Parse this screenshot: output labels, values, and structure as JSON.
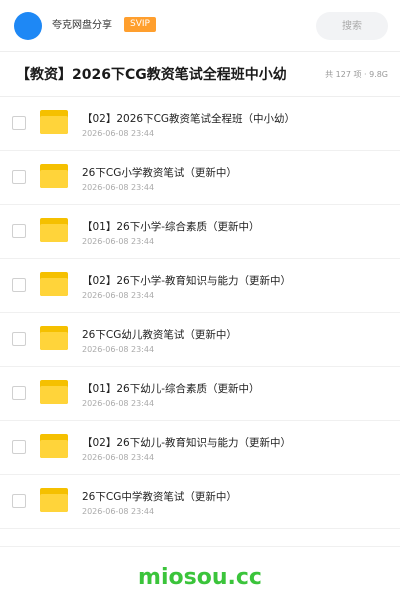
{
  "header": {
    "share_name": "夸克网盘分享",
    "badge": "SVIP",
    "search_placeholder": "搜索"
  },
  "folder": {
    "title": "【教资】2026下CG教资笔试全程班中小幼",
    "meta": "共 127 项 · 9.8G"
  },
  "items": [
    {
      "name": "【02】2026下CG教资笔试全程班（中小幼）",
      "date": "2026-06-08 23:44"
    },
    {
      "name": "26下CG小学教资笔试（更新中）",
      "date": "2026-06-08 23:44"
    },
    {
      "name": "【01】26下小学-综合素质（更新中）",
      "date": "2026-06-08 23:44"
    },
    {
      "name": "【02】26下小学-教育知识与能力（更新中）",
      "date": "2026-06-08 23:44"
    },
    {
      "name": "26下CG幼儿教资笔试（更新中）",
      "date": "2026-06-08 23:44"
    },
    {
      "name": "【01】26下幼儿-综合素质（更新中）",
      "date": "2026-06-08 23:44"
    },
    {
      "name": "【02】26下幼儿-教育知识与能力（更新中）",
      "date": "2026-06-08 23:44"
    },
    {
      "name": "26下CG中学教资笔试（更新中）",
      "date": "2026-06-08 23:44"
    }
  ],
  "watermark": "miosou.cc",
  "colors": {
    "avatar": "#1e88f5",
    "svip_badge": "#ff9f2e",
    "folder": "#ffd43a",
    "watermark": "#3bc43b"
  }
}
